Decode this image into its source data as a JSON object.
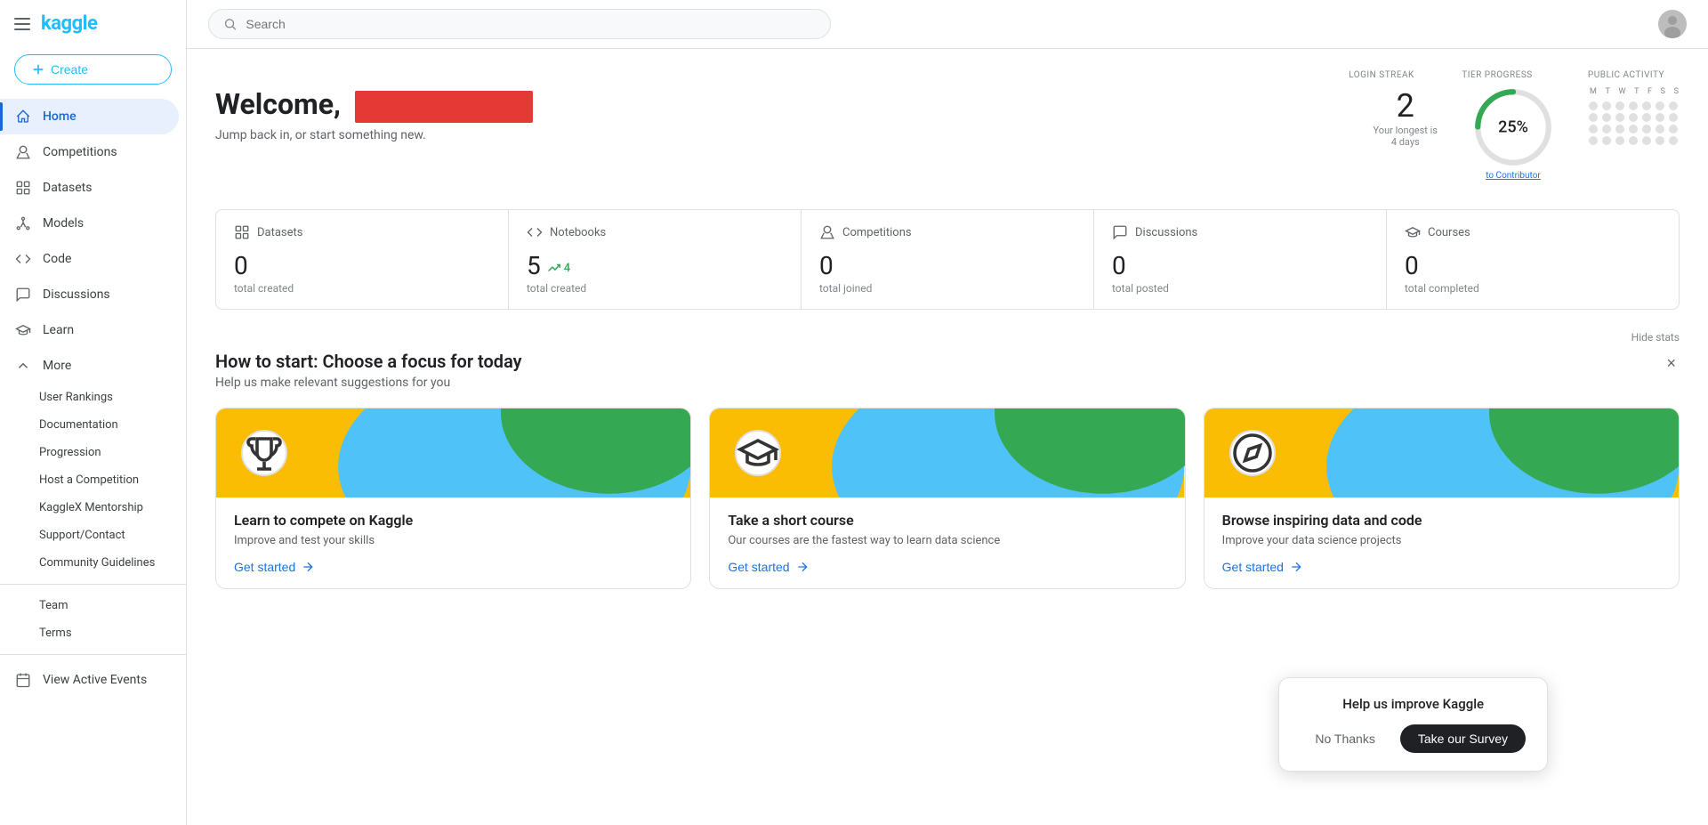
{
  "sidebar": {
    "logo": "kaggle",
    "create_button": "Create",
    "nav_items": [
      {
        "id": "home",
        "label": "Home",
        "active": true
      },
      {
        "id": "competitions",
        "label": "Competitions",
        "active": false
      },
      {
        "id": "datasets",
        "label": "Datasets",
        "active": false
      },
      {
        "id": "models",
        "label": "Models",
        "active": false
      },
      {
        "id": "code",
        "label": "Code",
        "active": false
      },
      {
        "id": "discussions",
        "label": "Discussions",
        "active": false
      },
      {
        "id": "learn",
        "label": "Learn",
        "active": false
      },
      {
        "id": "more",
        "label": "More",
        "active": false
      }
    ],
    "more_sub_items": [
      {
        "id": "user-rankings",
        "label": "User Rankings"
      },
      {
        "id": "documentation",
        "label": "Documentation"
      },
      {
        "id": "progression",
        "label": "Progression"
      },
      {
        "id": "host-competition",
        "label": "Host a Competition"
      },
      {
        "id": "kaggleX-mentorship",
        "label": "KaggleX Mentorship"
      },
      {
        "id": "support-contact",
        "label": "Support/Contact"
      },
      {
        "id": "community-guidelines",
        "label": "Community Guidelines"
      }
    ],
    "bottom_items": [
      {
        "id": "team",
        "label": "Team"
      },
      {
        "id": "terms",
        "label": "Terms"
      },
      {
        "id": "view-active-events",
        "label": "View Active Events"
      }
    ]
  },
  "topbar": {
    "search_placeholder": "Search"
  },
  "header": {
    "welcome_text": "Welcome,",
    "subtitle": "Jump back in, or start something new."
  },
  "stats_labels": {
    "login_streak": "LOGIN STREAK",
    "tier_progress": "TIER PROGRESS",
    "public_activity": "PUBLIC ACTIVITY"
  },
  "login_streak": {
    "number": "2",
    "sub_line1": "Your longest is",
    "sub_line2": "4 days"
  },
  "tier_progress": {
    "percentage": "25%",
    "link_text": "to Contributor",
    "arc_percent": 25,
    "color": "#34a853"
  },
  "activity_days": {
    "labels": [
      "M",
      "T",
      "W",
      "T",
      "F",
      "S",
      "S"
    ],
    "dots": [
      false,
      false,
      false,
      false,
      false,
      false,
      false,
      false,
      false,
      false,
      false,
      false,
      false,
      false,
      false,
      false,
      false,
      false,
      false,
      false,
      false,
      false,
      false,
      false,
      false,
      false,
      false,
      false
    ]
  },
  "section_stats": [
    {
      "id": "datasets",
      "icon": "datasets-icon",
      "label": "Datasets",
      "number": "0",
      "sub": "total created"
    },
    {
      "id": "notebooks",
      "icon": "notebooks-icon",
      "label": "Notebooks",
      "number": "5",
      "badge": "4",
      "sub": "total created"
    },
    {
      "id": "competitions",
      "icon": "competitions-icon",
      "label": "Competitions",
      "number": "0",
      "sub": "total joined"
    },
    {
      "id": "discussions",
      "icon": "discussions-icon",
      "label": "Discussions",
      "number": "0",
      "sub": "total posted"
    },
    {
      "id": "courses",
      "icon": "courses-icon",
      "label": "Courses",
      "number": "0",
      "sub": "total completed"
    }
  ],
  "hide_stats": "Hide stats",
  "how_to_start": {
    "title": "How to start: Choose a focus for today",
    "subtitle": "Help us make relevant suggestions for you"
  },
  "cards": [
    {
      "id": "compete",
      "title": "Learn to compete on Kaggle",
      "description": "Improve and test your skills",
      "cta": "Get started",
      "icon": "trophy",
      "banner_colors": {
        "yellow": "#fbbc04",
        "blue": "#4fc3f7",
        "green": "#34a853"
      }
    },
    {
      "id": "course",
      "title": "Take a short course",
      "description": "Our courses are the fastest way to learn data science",
      "cta": "Get started",
      "icon": "graduation",
      "banner_colors": {
        "yellow": "#fbbc04",
        "blue": "#4fc3f7",
        "green": "#34a853"
      }
    },
    {
      "id": "browse",
      "title": "Browse inspiring data and code",
      "description": "Improve your data science projects",
      "cta": "Get started",
      "icon": "compass",
      "banner_colors": {
        "yellow": "#fbbc04",
        "blue": "#4fc3f7",
        "green": "#34a853"
      }
    }
  ],
  "survey_popup": {
    "title": "Help us improve Kaggle",
    "no_thanks": "No Thanks",
    "take_survey": "Take our Survey"
  }
}
